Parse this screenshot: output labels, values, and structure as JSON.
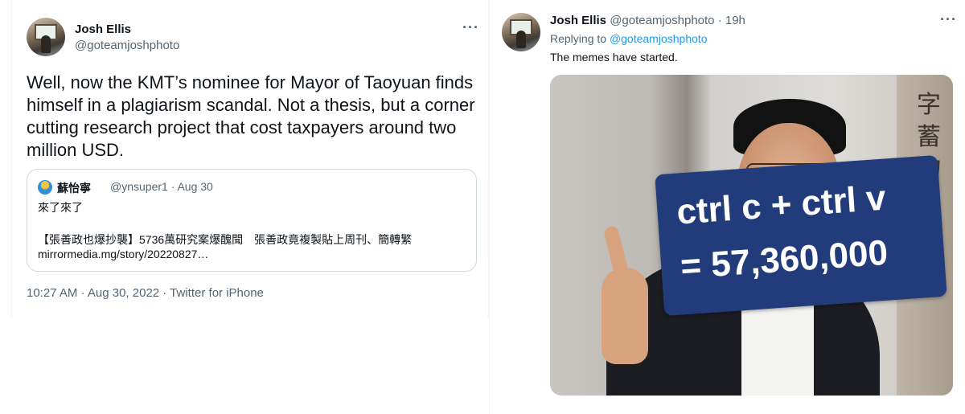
{
  "left_tweet": {
    "author_name": "Josh Ellis",
    "author_handle": "@goteamjoshphoto",
    "more_label": "···",
    "text": "Well, now the KMT’s nominee for Mayor of Taoyuan finds himself in a plagiarism scandal. Not a thesis, but a corner cutting research project that cost taxpayers around two million USD.",
    "quote": {
      "author_name": "蘇怡寧",
      "meta": "@ynsuper1 · Aug 30",
      "line1": "來了來了",
      "line2": "【張善政也爆抄襲】5736萬研究案爆醜聞　張善政竟複製貼上周刊、簡轉繁",
      "line3": "mirrormedia.mg/story/20220827…"
    },
    "timestamp": "10:27 AM · Aug 30, 2022 · Twitter for iPhone"
  },
  "right_tweet": {
    "author_name": "Josh Ellis",
    "author_handle": "@goteamjoshphoto",
    "time": "19h",
    "more_label": "···",
    "replying_prefix": "Replying to",
    "replying_handle": "@goteamjoshphoto",
    "text": "The memes have started.",
    "meme": {
      "line1": "ctrl c + ctrl v",
      "line2": "= 57,360,000",
      "calligraphy": "字\n蓄\n物",
      "box_color": "#223b7a"
    }
  },
  "colors": {
    "text": "#0f1419",
    "secondary": "#536471",
    "link": "#1d9bf0",
    "border": "#cfd9de"
  }
}
